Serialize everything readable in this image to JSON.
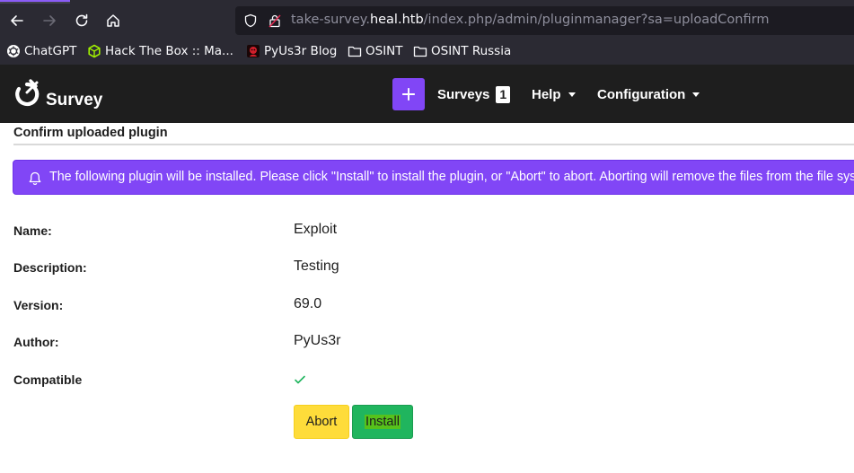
{
  "browser": {
    "url_prefix": "take-survey.",
    "url_host": "heal.htb",
    "url_path": "/index.php/admin/pluginmanager?sa=uploadConfirm",
    "bookmarks": [
      {
        "label": "ChatGPT",
        "icon": "chatgpt-icon"
      },
      {
        "label": "Hack The Box :: Ma...",
        "icon": "htb-cube-icon"
      },
      {
        "label": "PyUs3r Blog",
        "icon": "blog-favicon-icon"
      },
      {
        "label": "OSINT",
        "icon": "folder-icon"
      },
      {
        "label": "OSINT Russia",
        "icon": "folder-icon"
      }
    ]
  },
  "app": {
    "brand": "Survey",
    "menu": {
      "surveys_label": "Surveys",
      "surveys_count": "1",
      "help_label": "Help",
      "configuration_label": "Configuration"
    },
    "colors": {
      "accent": "#8146f6",
      "header_bg": "#1e1e1e",
      "abort_bg": "#fedc3a",
      "install_bg": "#20b55e",
      "check": "#20b55e"
    }
  },
  "page": {
    "title": "Confirm uploaded plugin",
    "alert_text": "The following plugin will be installed. Please click \"Install\" to install the plugin, or \"Abort\" to abort. Aborting will remove the files from the file sys",
    "fields": {
      "name_label": "Name:",
      "name_value": "Exploit",
      "description_label": "Description:",
      "description_value": "Testing",
      "version_label": "Version:",
      "version_value": "69.0",
      "author_label": "Author:",
      "author_value": "PyUs3r",
      "compatible_label": "Compatible"
    },
    "buttons": {
      "abort": "Abort",
      "install": "Install"
    }
  }
}
